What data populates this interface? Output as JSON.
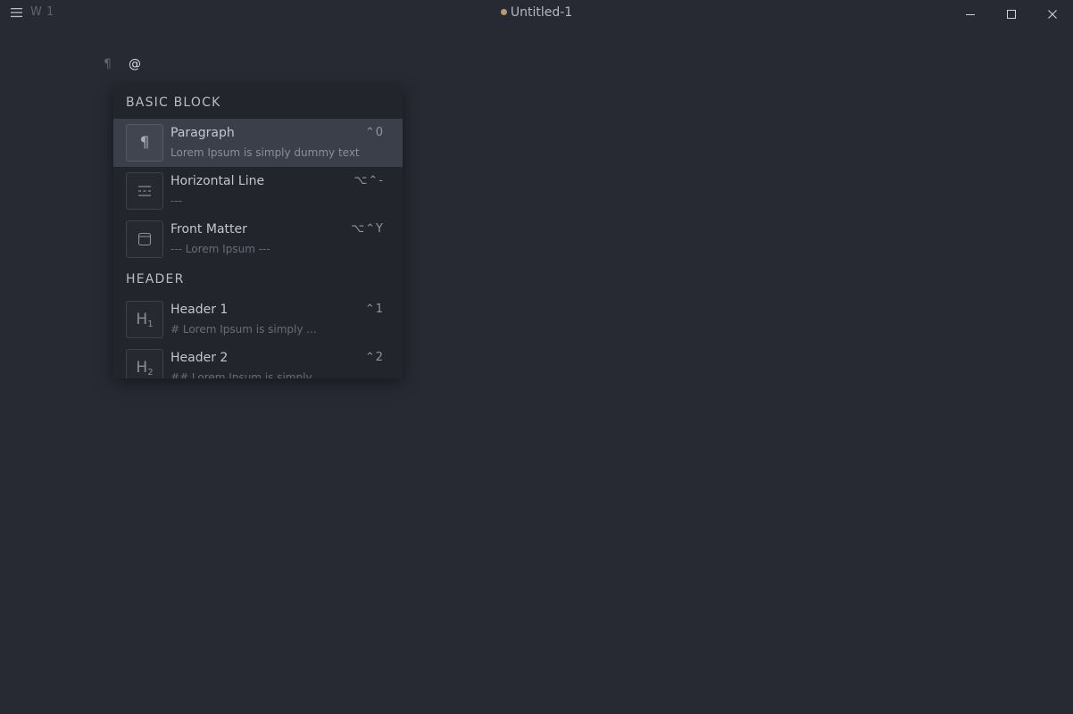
{
  "titlebar": {
    "menu_icon": "hamburger-icon",
    "word_count": "W 1",
    "document_title": "Untitled-1",
    "unsaved_dot_color": "#b89a70"
  },
  "editor": {
    "paragraph_marker": "¶",
    "line_text": "@"
  },
  "popup": {
    "sections": [
      {
        "title": "BASIC BLOCK",
        "items": [
          {
            "title": "Paragraph",
            "description": "Lorem Ipsum is simply dummy text",
            "shortcut": "⌃0",
            "icon": "paragraph-icon",
            "active": true
          },
          {
            "title": "Horizontal Line",
            "description": "---",
            "shortcut": "⌥⌃-",
            "icon": "horizontal-line-icon",
            "active": false
          },
          {
            "title": "Front Matter",
            "description": "--- Lorem Ipsum ---",
            "shortcut": "⌥⌃Y",
            "icon": "front-matter-icon",
            "active": false
          }
        ]
      },
      {
        "title": "HEADER",
        "items": [
          {
            "title": "Header 1",
            "description": "# Lorem Ipsum is simply ...",
            "shortcut": "⌃1",
            "icon": "header-1-icon",
            "icon_text": "H",
            "icon_sub": "1",
            "active": false
          },
          {
            "title": "Header 2",
            "description": "## Lorem Ipsum is simply ...",
            "shortcut": "⌃2",
            "icon": "header-2-icon",
            "icon_text": "H",
            "icon_sub": "2",
            "active": false
          }
        ]
      }
    ]
  }
}
